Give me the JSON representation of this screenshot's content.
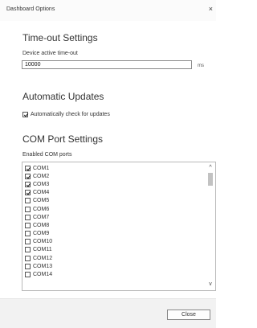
{
  "window": {
    "title": "Dashboard Options",
    "close_glyph": "×"
  },
  "timeout": {
    "heading": "Time-out Settings",
    "label": "Device active time-out",
    "value": "10000",
    "unit": "ms"
  },
  "updates": {
    "heading": "Automatic Updates",
    "checkbox_label": "Automatically check for updates",
    "checked": true
  },
  "com_ports": {
    "heading": "COM Port Settings",
    "label": "Enabled COM ports",
    "ports": [
      {
        "label": "COM1",
        "checked": true
      },
      {
        "label": "COM2",
        "checked": true
      },
      {
        "label": "COM3",
        "checked": true
      },
      {
        "label": "COM4",
        "checked": true
      },
      {
        "label": "COM5",
        "checked": false
      },
      {
        "label": "COM6",
        "checked": false
      },
      {
        "label": "COM7",
        "checked": false
      },
      {
        "label": "COM8",
        "checked": false
      },
      {
        "label": "COM9",
        "checked": false
      },
      {
        "label": "COM10",
        "checked": false
      },
      {
        "label": "COM11",
        "checked": false
      },
      {
        "label": "COM12",
        "checked": false
      },
      {
        "label": "COM13",
        "checked": false
      },
      {
        "label": "COM14",
        "checked": false
      }
    ],
    "scroll_up_glyph": "^",
    "scroll_down_glyph": "v"
  },
  "footer": {
    "close_label": "Close"
  }
}
